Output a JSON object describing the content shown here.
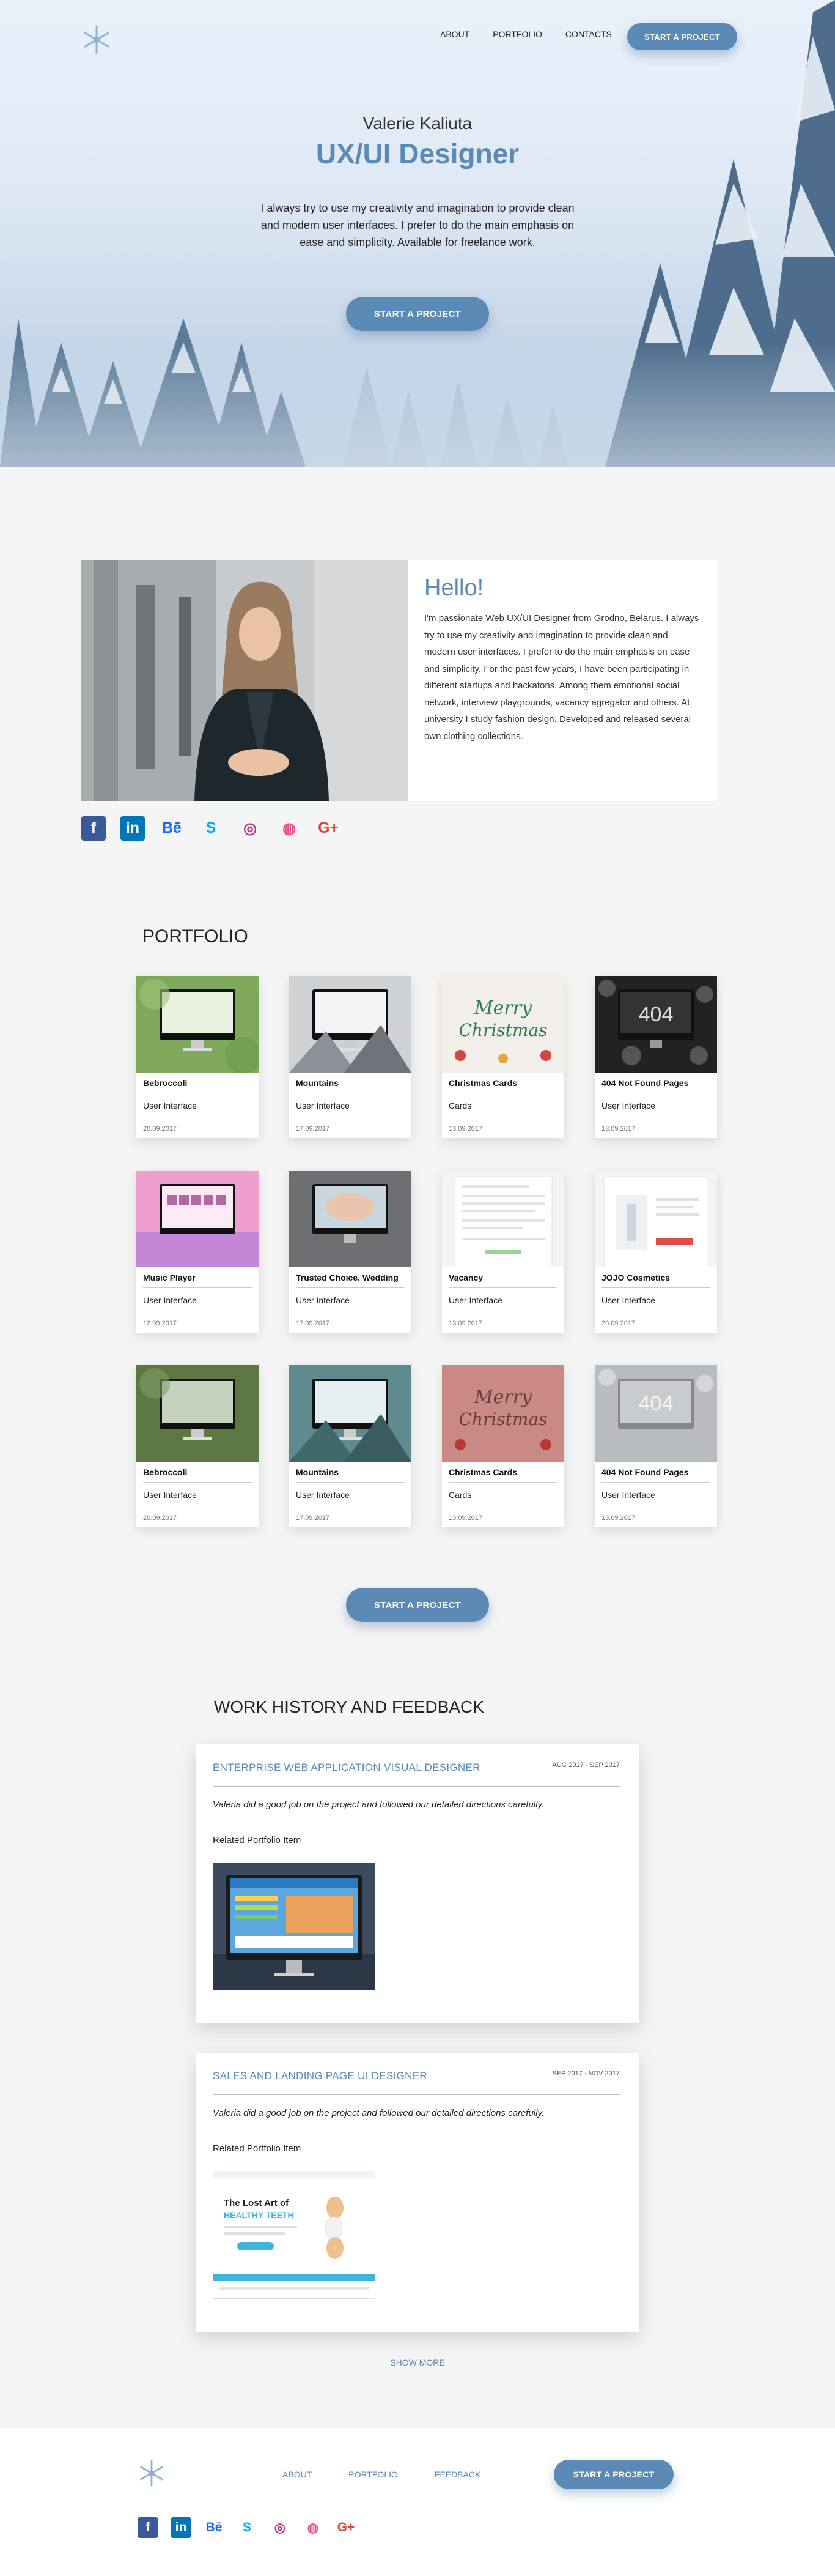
{
  "header": {
    "logo": "snowflake-icon",
    "nav": [
      "ABOUT",
      "PORTFOLIO",
      "CONTACTS"
    ],
    "cta": "START A PROJECT"
  },
  "hero": {
    "name": "Valerie Kaliuta",
    "role": "UX/UI Designer",
    "intro": "I always try to use my creativity and imagination to provide clean and modern user interfaces. I prefer to do the main emphasis on ease and simplicity. Available for freelance work.",
    "cta": "START A PROJECT"
  },
  "about": {
    "heading": "Hello!",
    "text": "I'm passionate Web UX/UI Designer from Grodno, Belarus. I always try to use my creativity and imagination to provide clean and modern user interfaces. I prefer to do the main emphasis on ease and simplicity. For the past few years, I have been participating in different startups and hackatons. Among them emotional social network, interview playgrounds, vacancy agregator and others. At university I study fashion design. Developed and released several own clothing collections.",
    "socials": [
      {
        "icon": "facebook-icon",
        "glyph": "f",
        "color": "#3b5998"
      },
      {
        "icon": "linkedin-icon",
        "glyph": "in",
        "color": "#0077b5"
      },
      {
        "icon": "behance-icon",
        "glyph": "Bē",
        "color": "#1769ff"
      },
      {
        "icon": "skype-icon",
        "glyph": "S",
        "color": "#00aff0"
      },
      {
        "icon": "instagram-icon",
        "glyph": "◎",
        "color": "#c13584"
      },
      {
        "icon": "dribbble-icon",
        "glyph": "◍",
        "color": "#ea4c89"
      },
      {
        "icon": "google-plus-icon",
        "glyph": "G+",
        "color": "#dd4b39"
      }
    ]
  },
  "portfolio": {
    "title": "PORTFOLIO",
    "items": [
      {
        "title": "Bebroccoli",
        "category": "User Interface",
        "date": "20.09.2017",
        "thumb": "green"
      },
      {
        "title": "Mountains",
        "category": "User Interface",
        "date": "17.09.2017",
        "thumb": "mountain"
      },
      {
        "title": "Christmas Cards",
        "category": "Cards",
        "date": "13.09.2017",
        "thumb": "christmas"
      },
      {
        "title": "404 Not Found Pages",
        "category": "User Interface",
        "date": "13.09.2017",
        "thumb": "dark404"
      },
      {
        "title": "Music Player",
        "category": "User Interface",
        "date": "12.09.2017",
        "thumb": "pink"
      },
      {
        "title": "Trusted Choice. Wedding",
        "category": "User Interface",
        "date": "17.09.2017",
        "thumb": "wedding"
      },
      {
        "title": "Vacancy",
        "category": "User Interface",
        "date": "13.09.2017",
        "thumb": "doc"
      },
      {
        "title": "JOJO Cosmetics",
        "category": "User Interface",
        "date": "20.09.2017",
        "thumb": "cosmetics"
      },
      {
        "title": "Bebroccoli",
        "category": "User Interface",
        "date": "20.09.2017",
        "thumb": "green-dim"
      },
      {
        "title": "Mountains",
        "category": "User Interface",
        "date": "17.09.2017",
        "thumb": "mountain-teal"
      },
      {
        "title": "Christmas Cards",
        "category": "Cards",
        "date": "13.09.2017",
        "thumb": "christmas-dim"
      },
      {
        "title": "404 Not Found Pages",
        "category": "User Interface",
        "date": "13.09.2017",
        "thumb": "grey404"
      }
    ],
    "thumb_text": {
      "christmas": "Merry Christmas",
      "notfound": "404"
    },
    "cta": "START A PROJECT"
  },
  "work": {
    "title": "WORK HISTORY AND FEEDBACK",
    "items": [
      {
        "role": "ENTERPRISE WEB APPLICATION VISUAL DESIGNER",
        "period": "AUG 2017 - SEP 2017",
        "feedback": "Valeria did a good job on the project and followed our detailed directions carefully.",
        "related": "Related Portfolio Item"
      },
      {
        "role": "SALES AND LANDING PAGE UI DESIGNER",
        "period": "SEP 2017 - NOV 2017",
        "feedback": "Valeria did a good job on the project and followed our detailed directions carefully.",
        "related": "Related Portfolio Item",
        "preview_heading": "The Lost Art of",
        "preview_sub": "HEALTHY TEETH"
      }
    ],
    "show_more": "SHOW MORE"
  },
  "footer": {
    "logo": "snowflake-icon",
    "nav": [
      "ABOUT",
      "PORTFOLIO",
      "FEEDBACK"
    ],
    "cta": "START A PROJECT"
  },
  "colors": {
    "accent": "#5b8ab6",
    "background": "#f5f5f5"
  }
}
